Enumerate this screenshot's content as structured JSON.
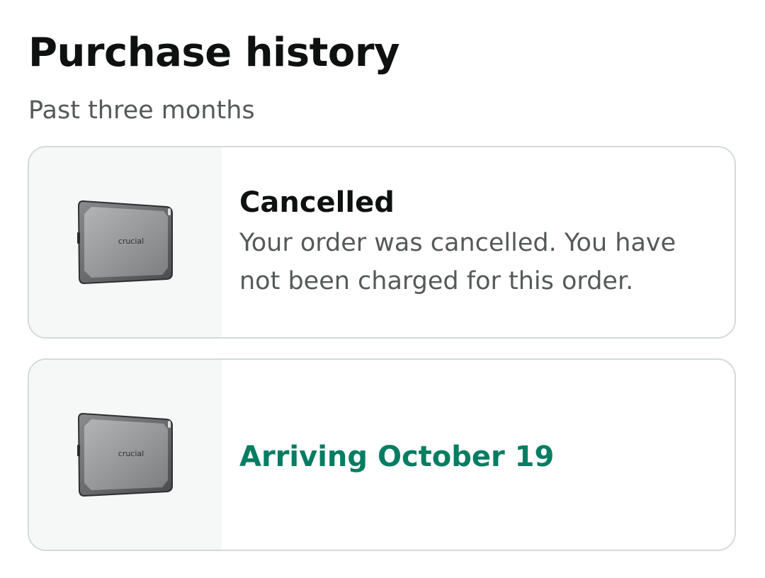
{
  "header": {
    "title": "Purchase history",
    "subtitle": "Past three months"
  },
  "orders": [
    {
      "product_brand": "crucial",
      "product_icon": "portable-ssd-icon",
      "status": "Cancelled",
      "description": "Your order was cancelled. You have not been charged for this order."
    },
    {
      "product_brand": "crucial",
      "product_icon": "portable-ssd-icon",
      "status": "Arriving October 19"
    }
  ],
  "colors": {
    "arriving_status": "#067d62",
    "card_border": "#d5d9d9",
    "thumb_background": "#f6f7f7"
  }
}
